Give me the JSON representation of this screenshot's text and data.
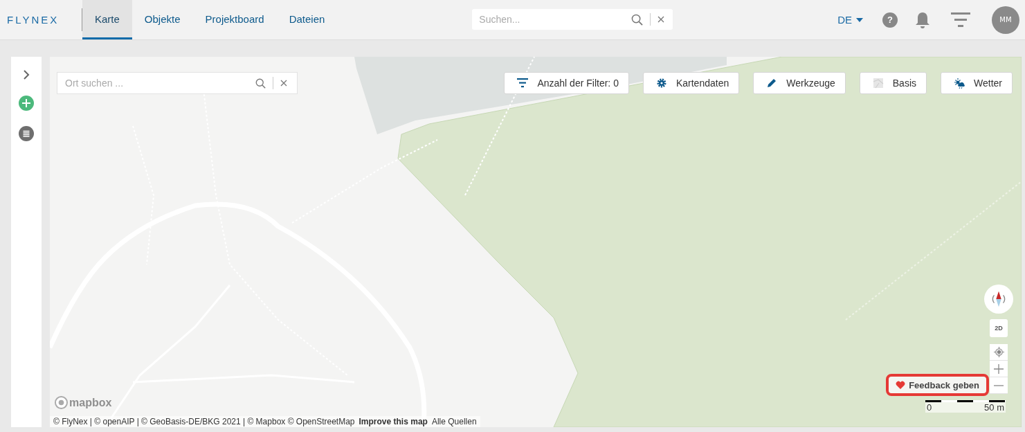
{
  "header": {
    "logo": "FLYNEX",
    "tabs": [
      {
        "label": "Karte",
        "selected": true
      },
      {
        "label": "Objekte",
        "selected": false
      },
      {
        "label": "Projektboard",
        "selected": false
      },
      {
        "label": "Dateien",
        "selected": false
      }
    ],
    "search": {
      "placeholder": "Suchen..."
    },
    "language": "DE",
    "help": "?",
    "avatar": "MM"
  },
  "map": {
    "search": {
      "placeholder": "Ort suchen ..."
    },
    "toolbar": [
      {
        "kind": "filter",
        "label": "Anzahl der Filter: 0"
      },
      {
        "kind": "gear",
        "label": "Kartendaten"
      },
      {
        "kind": "pencil",
        "label": "Werkzeuge"
      },
      {
        "kind": "basemap",
        "label": "Basis"
      },
      {
        "kind": "weather",
        "label": "Wetter"
      }
    ],
    "view_toggle": "2D",
    "feedback": "Feedback geben",
    "scale": {
      "start": "0",
      "end": "50 m"
    },
    "mapbox_logo": "mapbox",
    "attribution": {
      "text": "© FlyNex | © openAIP | © GeoBasis-DE/BKG 2021 | © Mapbox © OpenStreetMap",
      "links": [
        "Improve this map",
        "Alle Quellen"
      ]
    }
  }
}
